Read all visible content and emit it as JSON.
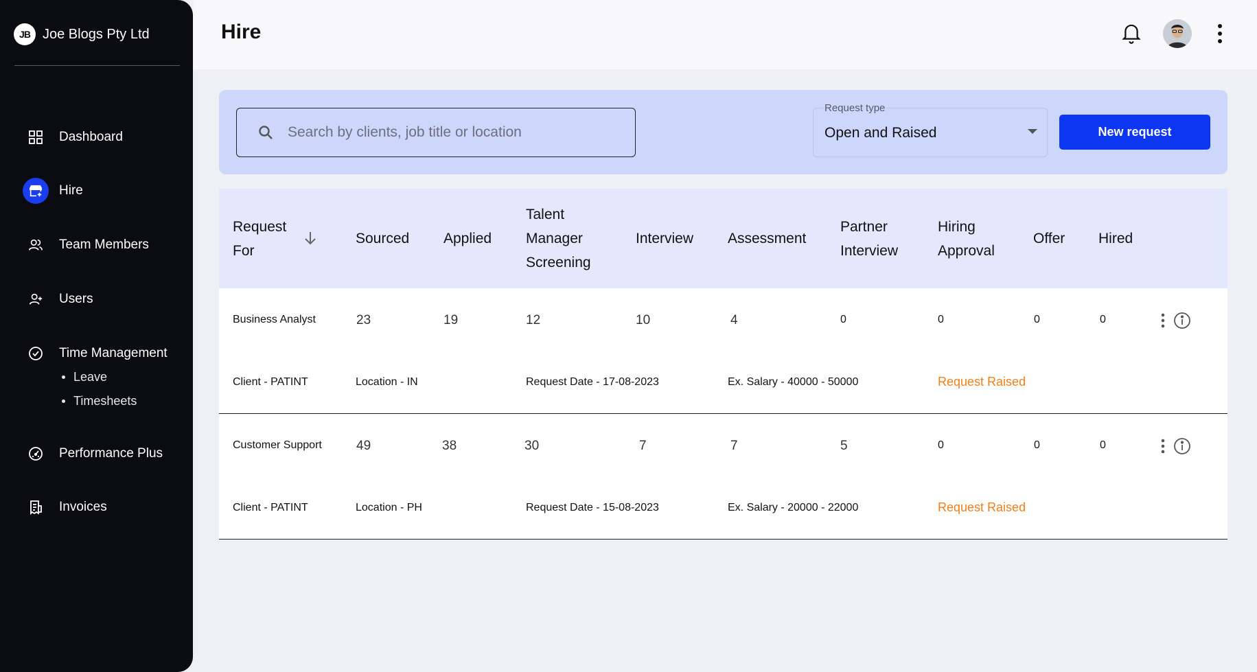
{
  "brand": {
    "logo_text": "JB",
    "name": "Joe Blogs Pty Ltd"
  },
  "nav": {
    "dashboard": "Dashboard",
    "hire": "Hire",
    "team_members": "Team Members",
    "users": "Users",
    "time_management": "Time Management",
    "time_sub": [
      "Leave",
      "Timesheets"
    ],
    "performance_plus": "Performance Plus",
    "invoices": "Invoices"
  },
  "header": {
    "title": "Hire"
  },
  "filters": {
    "search_placeholder": "Search by clients, job title or location",
    "search_value": "",
    "request_type_label": "Request type",
    "request_type_value": "Open and Raised",
    "new_request_label": "New request"
  },
  "table": {
    "columns": [
      "Request For",
      "Sourced",
      "Applied",
      "Talent Manager Screening",
      "Interview",
      "Assessment",
      "Partner Interview",
      "Hiring Approval",
      "Offer",
      "Hired"
    ],
    "rows": [
      {
        "request_for": "Business Analyst",
        "sourced": "23",
        "applied": "19",
        "screening": "12",
        "interview": "10",
        "assessment": "4",
        "partner_interview": "0",
        "hiring_approval": "0",
        "offer": "0",
        "hired": "0",
        "client": "Client - PATINT",
        "location": "Location - IN",
        "request_date": "Request Date - 17-08-2023",
        "salary": "Ex. Salary - 40000 - 50000",
        "status": "Request Raised"
      },
      {
        "request_for": "Customer Support",
        "sourced": "49",
        "applied": "38",
        "screening": "30",
        "interview": "7",
        "assessment": "7",
        "partner_interview": "5",
        "hiring_approval": "0",
        "offer": "0",
        "hired": "0",
        "client": "Client - PATINT",
        "location": "Location - PH",
        "request_date": "Request Date - 15-08-2023",
        "salary": "Ex. Salary - 20000 - 22000",
        "status": "Request Raised"
      }
    ]
  },
  "colors": {
    "sidebar_bg": "#0b0b12",
    "accent": "#0c36f2",
    "filter_bg": "#ccd7fb",
    "table_header_bg": "#e3e8fd",
    "status_color": "#f0801a"
  }
}
